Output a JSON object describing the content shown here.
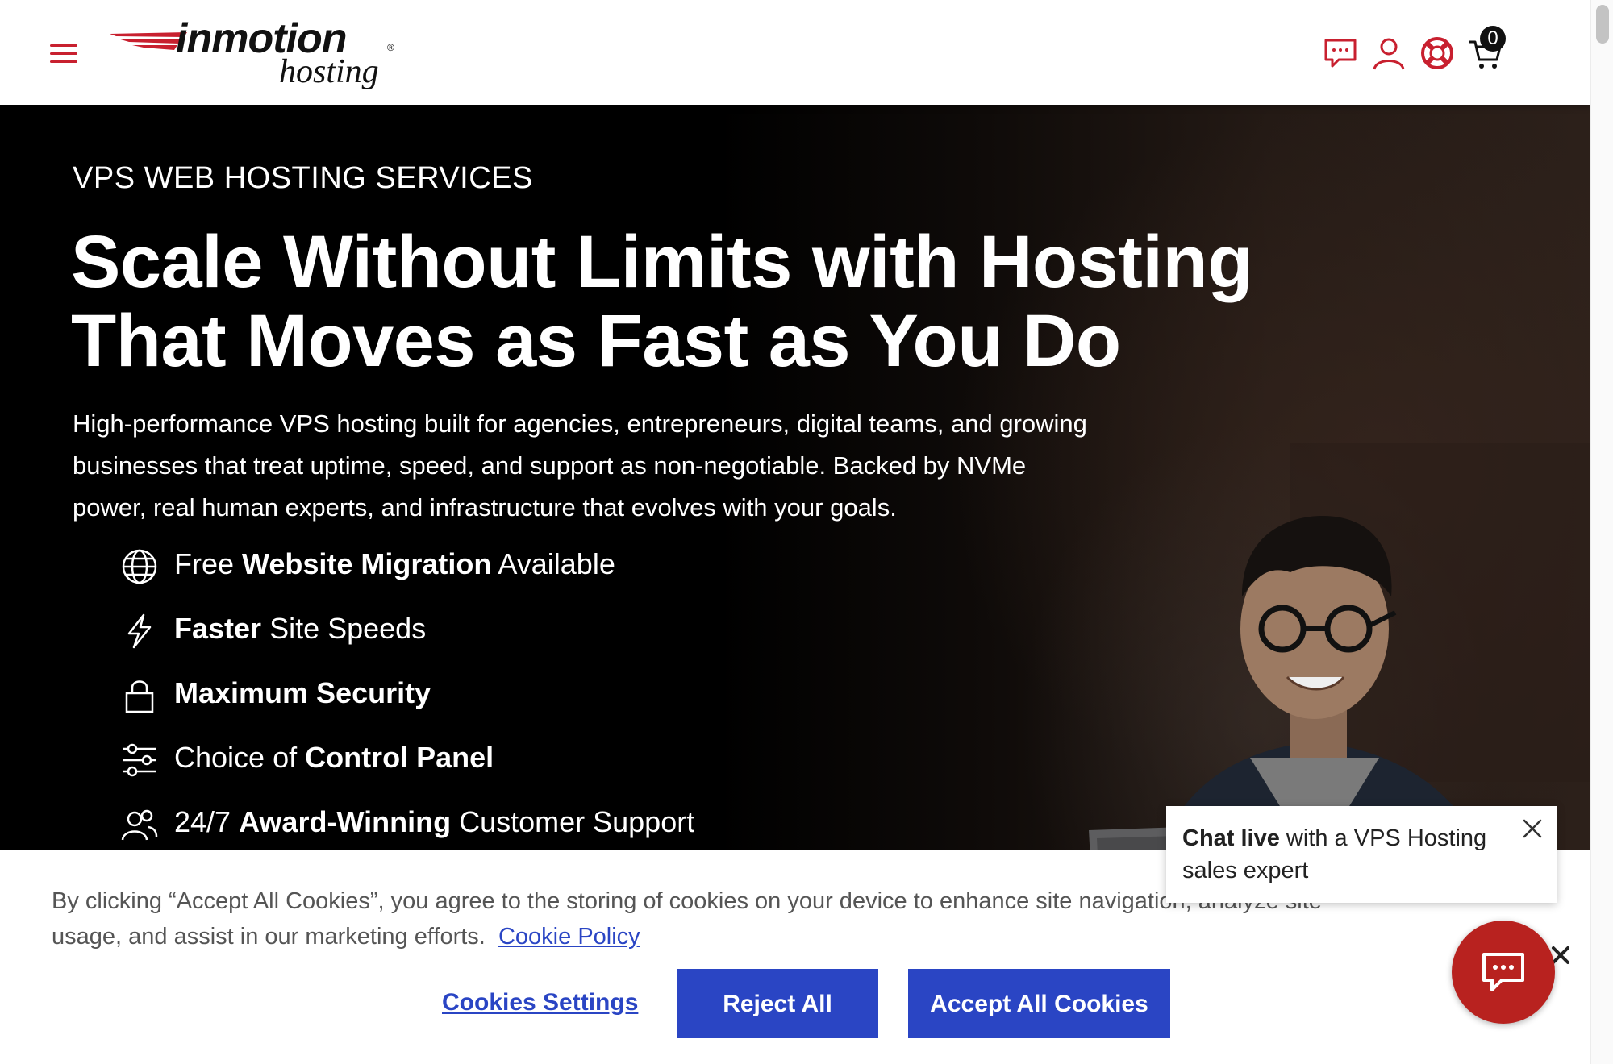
{
  "header": {
    "menu_icon": "hamburger-icon",
    "logo": {
      "brand": "inmotion",
      "sub": "hosting",
      "registered": "®"
    },
    "icons": [
      "chat-icon",
      "user-icon",
      "support-icon",
      "cart-icon"
    ],
    "cart_count": "0"
  },
  "hero": {
    "eyebrow": "VPS WEB HOSTING SERVICES",
    "headline_line1": "Scale Without Limits with Hosting",
    "headline_line2": "That Moves as Fast as You Do",
    "description_line1": "High-performance VPS hosting built for agencies, entrepreneurs, digital teams, and growing",
    "description_line2": "businesses that treat uptime, speed, and support as non-negotiable. Backed by NVMe",
    "description_line3": "power, real human experts, and infrastructure that evolves with your goals.",
    "features": [
      {
        "icon": "globe-icon",
        "pre": "Free ",
        "bold": "Website Migration",
        "post": " Available"
      },
      {
        "icon": "lightning-icon",
        "pre": "",
        "bold": "Faster",
        "post": " Site Speeds"
      },
      {
        "icon": "lock-icon",
        "pre": "",
        "bold": "Maximum Security",
        "post": ""
      },
      {
        "icon": "sliders-icon",
        "pre": "Choice of ",
        "bold": "Control Panel",
        "post": ""
      },
      {
        "icon": "people-icon",
        "pre": "24/7 ",
        "bold": "Award-Winning",
        "post": " Customer Support"
      }
    ]
  },
  "cookie_banner": {
    "text_line1": "By clicking “Accept All Cookies”, you agree to the storing of cookies on your device to enhance site navigation, analyze site",
    "text_line2": "usage, and assist in our marketing efforts.",
    "policy_link": "Cookie Policy",
    "settings_label": "Cookies Settings",
    "reject_label": "Reject All",
    "accept_label": "Accept All Cookies"
  },
  "chat": {
    "popup_bold": "Chat live",
    "popup_rest": " with a VPS Hosting sales expert",
    "launcher_icon": "chat-bubble-icon"
  },
  "colors": {
    "brand_red": "#c8202f",
    "button_blue": "#2a45c4",
    "chat_red": "#b8221f"
  }
}
